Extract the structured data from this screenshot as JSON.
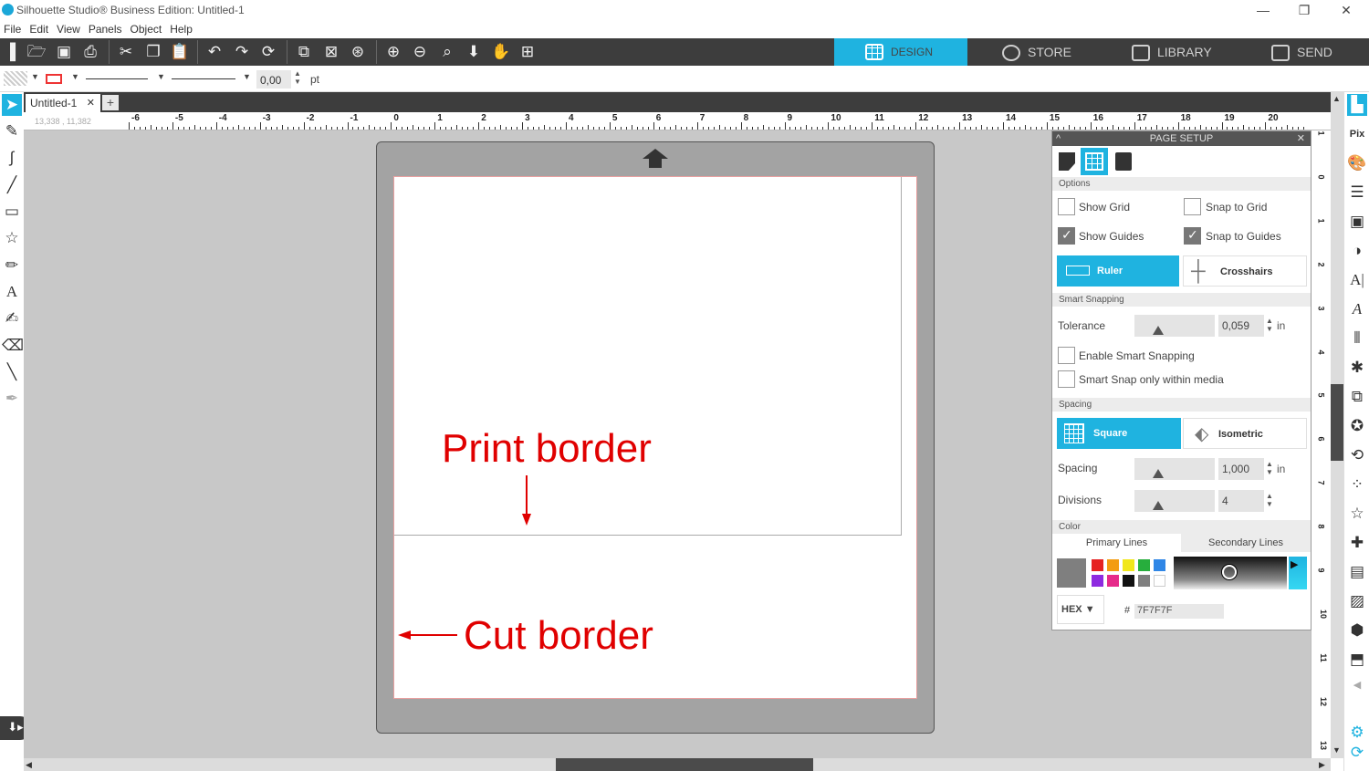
{
  "window": {
    "title": "Silhouette Studio® Business Edition: Untitled-1"
  },
  "menu": [
    "File",
    "Edit",
    "View",
    "Panels",
    "Object",
    "Help"
  ],
  "nav_tabs": {
    "design": "DESIGN",
    "store": "STORE",
    "library": "LIBRARY",
    "send": "SEND"
  },
  "props": {
    "line_width": "0,00",
    "unit": "pt"
  },
  "document": {
    "tab_name": "Untitled-1",
    "coords": "13,338 , 11,382"
  },
  "ruler": {
    "h_labels": [
      "-6",
      "-5",
      "-4",
      "-3",
      "-2",
      "-1",
      "0",
      "1",
      "2",
      "3",
      "4",
      "5",
      "6",
      "7",
      "8",
      "9",
      "10",
      "11",
      "12",
      "13",
      "14",
      "15",
      "16",
      "17",
      "18",
      "19",
      "20"
    ],
    "v_labels": [
      "1",
      "0",
      "1",
      "2",
      "3",
      "4",
      "5",
      "6",
      "7",
      "8",
      "9",
      "10",
      "11",
      "12",
      "13"
    ]
  },
  "annotations": {
    "print_border": "Print border",
    "cut_border": "Cut border"
  },
  "page_setup": {
    "title": "PAGE SETUP",
    "options_header": "Options",
    "show_grid": "Show Grid",
    "snap_to_grid": "Snap to Grid",
    "show_guides": "Show Guides",
    "snap_to_guides": "Snap to Guides",
    "ruler": "Ruler",
    "crosshairs": "Crosshairs",
    "smart_snapping_header": "Smart Snapping",
    "tolerance_label": "Tolerance",
    "tolerance_value": "0,059",
    "unit_in": "in",
    "enable_smart_snapping": "Enable Smart Snapping",
    "smart_snap_media": "Smart Snap only within media",
    "spacing_header": "Spacing",
    "square": "Square",
    "isometric": "Isometric",
    "spacing_label": "Spacing",
    "spacing_value": "1,000",
    "divisions_label": "Divisions",
    "divisions_value": "4",
    "color_header": "Color",
    "primary_lines": "Primary Lines",
    "secondary_lines": "Secondary Lines",
    "hex_label": "HEX",
    "hex_prefix": "#",
    "hex_value": "7F7F7F",
    "swatches": [
      "#e62222",
      "#f39c12",
      "#f1e71b",
      "#27ae3d",
      "#2f86e6",
      "#8e2ae0",
      "#e62a8a",
      "#111111",
      "#7f7f7f",
      "#ffffff"
    ],
    "current_color": "#7f7f7f"
  },
  "colors": {
    "accent": "#1fb3e0",
    "toolbar": "#3d3d3d",
    "annotation": "#e00000"
  }
}
